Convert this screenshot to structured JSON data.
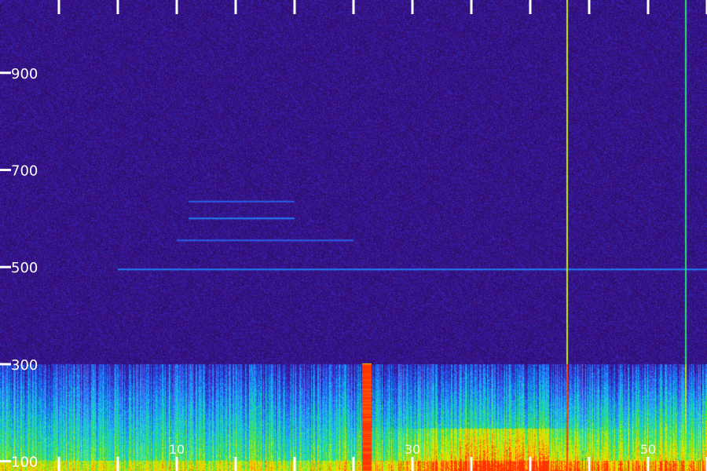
{
  "chart_data": {
    "type": "heatmap",
    "title": "",
    "xlabel": "",
    "ylabel": "",
    "x_tick_labels": [
      {
        "value": 10,
        "label": "10"
      },
      {
        "value": 30,
        "label": "30"
      },
      {
        "value": 50,
        "label": "50"
      }
    ],
    "x_ticks": [
      0,
      5,
      10,
      15,
      20,
      25,
      30,
      35,
      40,
      45,
      50,
      55
    ],
    "y_ticks": [
      {
        "value": 100,
        "label": "100"
      },
      {
        "value": 300,
        "label": "300"
      },
      {
        "value": 500,
        "label": "500"
      },
      {
        "value": 700,
        "label": "700"
      },
      {
        "value": 900,
        "label": "900"
      }
    ],
    "xlim": [
      -5,
      55
    ],
    "ylim": [
      80,
      1050
    ],
    "band_top": 300,
    "horizontal_lines": [
      {
        "y": 495,
        "x_start": 5,
        "x_end": 55,
        "strength": 0.35
      },
      {
        "y": 555,
        "x_start": 10,
        "x_end": 25,
        "strength": 0.3
      },
      {
        "y": 600,
        "x_start": 11,
        "x_end": 20,
        "strength": 0.35
      },
      {
        "y": 635,
        "x_start": 11,
        "x_end": 20,
        "strength": 0.3
      }
    ],
    "vertical_lines": [
      {
        "x": 43.1,
        "y_start": 80,
        "y_end": 1050,
        "strength": 0.75,
        "peak_at_low": 1.0
      },
      {
        "x": 53.2,
        "y_start": 80,
        "y_end": 1050,
        "strength": 0.6,
        "peak_at_low": 0.5
      },
      {
        "x": 26.1,
        "y_start": 80,
        "y_end": 300,
        "strength": 0.85,
        "peak_at_low": 0.9
      }
    ],
    "colormap": [
      "#1c0c40",
      "#3b0f8a",
      "#2f3fe0",
      "#1e90ff",
      "#19d3d3",
      "#33e060",
      "#c8f000",
      "#ffcc00",
      "#ff3300"
    ],
    "colors": {
      "background": "#1c0c40",
      "tick": "#ffffff"
    }
  }
}
